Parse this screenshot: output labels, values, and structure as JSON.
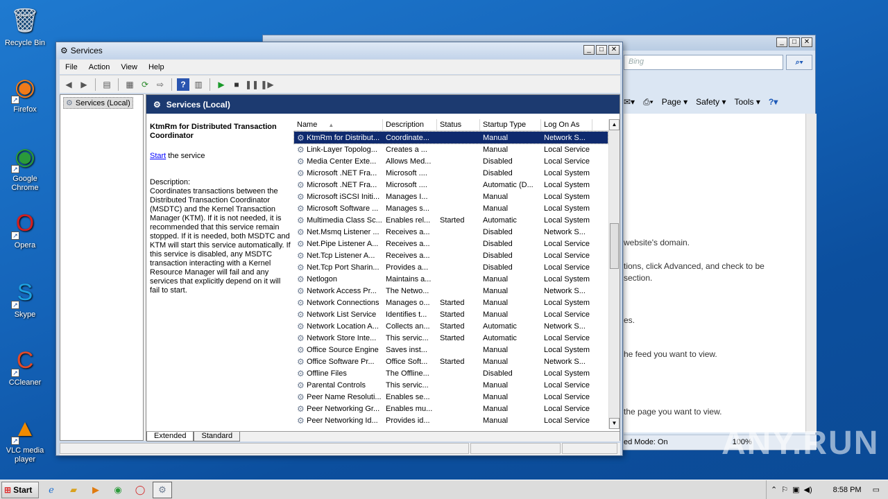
{
  "desktop": {
    "icons": [
      {
        "label": "Recycle Bin",
        "icon": "recycle-bin-icon"
      },
      {
        "label": "Firefox",
        "icon": "firefox-icon"
      },
      {
        "label": "Google Chrome",
        "icon": "chrome-icon"
      },
      {
        "label": "Opera",
        "icon": "opera-icon"
      },
      {
        "label": "Skype",
        "icon": "skype-icon"
      },
      {
        "label": "CCleaner",
        "icon": "ccleaner-icon"
      },
      {
        "label": "VLC media player",
        "icon": "vlc-icon"
      }
    ]
  },
  "ie": {
    "search_placeholder": "Bing",
    "cmd_page": "Page",
    "cmd_safety": "Safety",
    "cmd_tools": "Tools",
    "content_lines": [
      "website's domain.",
      "tions, click Advanced, and check to be",
      "section.",
      "es.",
      "he feed you want to view.",
      "the page you want to view."
    ],
    "status_mode": "ed Mode: On",
    "zoom": "100%"
  },
  "services": {
    "title": "Services",
    "menu": [
      "File",
      "Action",
      "View",
      "Help"
    ],
    "tree_item": "Services (Local)",
    "panel_header": "Services (Local)",
    "selected_title": "KtmRm for Distributed Transaction Coordinator",
    "start_link": "Start",
    "start_rest": " the service",
    "description_label": "Description:",
    "description": "Coordinates transactions between the Distributed Transaction Coordinator (MSDTC) and the Kernel Transaction Manager (KTM). If it is not needed, it is recommended that this service remain stopped. If it is needed, both MSDTC and KTM will start this service automatically. If this service is disabled, any MSDTC transaction interacting with a Kernel Resource Manager will fail and any services that explicitly depend on it will fail to start.",
    "columns": [
      "Name",
      "Description",
      "Status",
      "Startup Type",
      "Log On As"
    ],
    "rows": [
      [
        "KtmRm for Distribut...",
        "Coordinate...",
        "",
        "Manual",
        "Network S..."
      ],
      [
        "Link-Layer Topolog...",
        "Creates a ...",
        "",
        "Manual",
        "Local Service"
      ],
      [
        "Media Center Exte...",
        "Allows Med...",
        "",
        "Disabled",
        "Local Service"
      ],
      [
        "Microsoft .NET Fra...",
        "Microsoft ....",
        "",
        "Disabled",
        "Local System"
      ],
      [
        "Microsoft .NET Fra...",
        "Microsoft ....",
        "",
        "Automatic (D...",
        "Local System"
      ],
      [
        "Microsoft iSCSI Initi...",
        "Manages I...",
        "",
        "Manual",
        "Local System"
      ],
      [
        "Microsoft Software ...",
        "Manages s...",
        "",
        "Manual",
        "Local System"
      ],
      [
        "Multimedia Class Sc...",
        "Enables rel...",
        "Started",
        "Automatic",
        "Local System"
      ],
      [
        "Net.Msmq Listener ...",
        "Receives a...",
        "",
        "Disabled",
        "Network S..."
      ],
      [
        "Net.Pipe Listener A...",
        "Receives a...",
        "",
        "Disabled",
        "Local Service"
      ],
      [
        "Net.Tcp Listener A...",
        "Receives a...",
        "",
        "Disabled",
        "Local Service"
      ],
      [
        "Net.Tcp Port Sharin...",
        "Provides a...",
        "",
        "Disabled",
        "Local Service"
      ],
      [
        "Netlogon",
        "Maintains a...",
        "",
        "Manual",
        "Local System"
      ],
      [
        "Network Access Pr...",
        "The Netwo...",
        "",
        "Manual",
        "Network S..."
      ],
      [
        "Network Connections",
        "Manages o...",
        "Started",
        "Manual",
        "Local System"
      ],
      [
        "Network List Service",
        "Identifies t...",
        "Started",
        "Manual",
        "Local Service"
      ],
      [
        "Network Location A...",
        "Collects an...",
        "Started",
        "Automatic",
        "Network S..."
      ],
      [
        "Network Store Inte...",
        "This servic...",
        "Started",
        "Automatic",
        "Local Service"
      ],
      [
        "Office  Source Engine",
        "Saves inst...",
        "",
        "Manual",
        "Local System"
      ],
      [
        "Office Software Pr...",
        "Office Soft...",
        "Started",
        "Manual",
        "Network S..."
      ],
      [
        "Offline Files",
        "The Offline...",
        "",
        "Disabled",
        "Local System"
      ],
      [
        "Parental Controls",
        "This servic...",
        "",
        "Manual",
        "Local Service"
      ],
      [
        "Peer Name Resoluti...",
        "Enables se...",
        "",
        "Manual",
        "Local Service"
      ],
      [
        "Peer Networking Gr...",
        "Enables mu...",
        "",
        "Manual",
        "Local Service"
      ],
      [
        "Peer Networking Id...",
        "Provides id...",
        "",
        "Manual",
        "Local Service"
      ]
    ],
    "tabs": [
      "Extended",
      "Standard"
    ]
  },
  "taskbar": {
    "start_label": "Start",
    "clock": "8:58 PM"
  },
  "watermark": "ANY.RUN"
}
